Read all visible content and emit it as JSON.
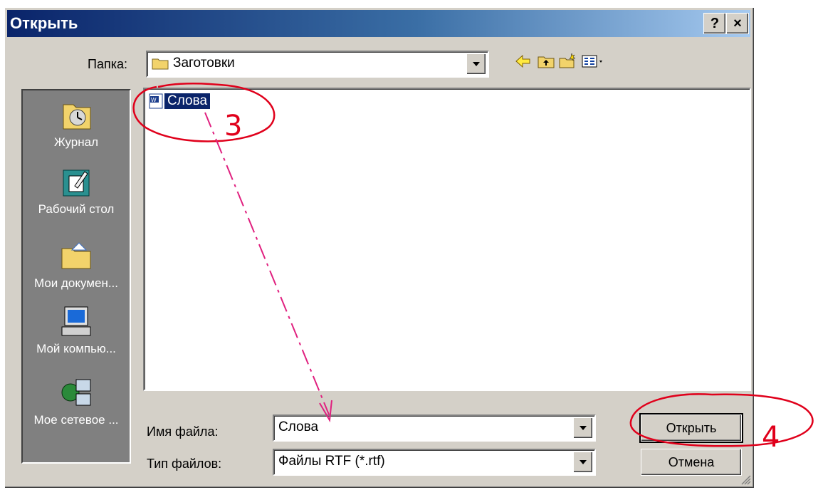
{
  "window": {
    "title": "Открыть",
    "help_label": "?",
    "close_label": "×"
  },
  "toolbar": {
    "folder_label": "Папка:",
    "folder_value": "Заготовки"
  },
  "places": [
    {
      "label": "Журнал"
    },
    {
      "label": "Рабочий стол"
    },
    {
      "label": "Мои докумен..."
    },
    {
      "label": "Мой компью..."
    },
    {
      "label": "Мое сетевое ..."
    }
  ],
  "files": [
    {
      "name": "Слова",
      "selected": true
    }
  ],
  "form": {
    "filename_label": "Имя файла:",
    "filename_value": "Слова",
    "filetype_label": "Тип файлов:",
    "filetype_value": "Файлы RTF (*.rtf)"
  },
  "buttons": {
    "open": "Открыть",
    "cancel": "Отмена"
  },
  "annotations": {
    "step3": "3",
    "step4": "4",
    "color": "#e0001b",
    "arrow_color": "#e0207f"
  }
}
